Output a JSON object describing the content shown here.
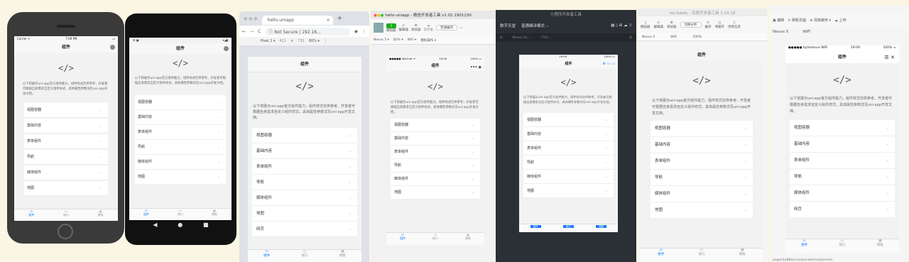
{
  "page": {
    "title": "组件",
    "code": "</>",
    "desc": "以下将展示uni-app官方组件能力，组件样式仅供参考，开发者可根据自身需求自定义组件样式，具体属性参数详见uni-app开发文档。"
  },
  "items": [
    "视图容器",
    "基础内容",
    "表单组件",
    "导航",
    "媒体组件",
    "地图",
    "网页"
  ],
  "tabs": {
    "home": "组件",
    "api": "接口",
    "tpl": "模板"
  },
  "iphone": {
    "carrier": "Carrier ᯤ",
    "time": "7:09 PM",
    "battery": "▭"
  },
  "browser": {
    "tab": "hello-uniapp",
    "secure": "Not Secure",
    "url": "192.16...",
    "device": "Pixel 2 ▾",
    "w": "411",
    "h": "731",
    "zoom": "80% ▾"
  },
  "wx": {
    "title": "hello-uniapp - 微信开发者工具 v1.02.1901230",
    "t1": "模拟器",
    "t2": "编辑器",
    "t3": "调试器",
    "t4": "云开发",
    "compile": "普通编译",
    "device": "Nexus 5 ▾",
    "zoom": "85% ▾",
    "net": "WiFi ▾",
    "op": "模拟操作 ▾",
    "sb_left": "●●●●● WeChat ᯤ",
    "sb_time": "19:09",
    "sb_right": "100% ▭"
  },
  "alipay": {
    "title": "小程序开发者工具",
    "left": "数字天堂",
    "mode": "普通编译模式 ⌵",
    "device": "Nexus 5x ⌵",
    "zoom": "75% ⌵",
    "sb_time": "19:09",
    "sb_right": "100% ▭"
  },
  "baidu": {
    "title": "mc-baidu - 百度开发者工具 1.14.18",
    "t1": "模拟器",
    "t2": "编辑器",
    "t3": "调试器",
    "mode": "切换分析",
    "compile": "编译",
    "clear": "清缓存",
    "detail": "项目信息",
    "device": "Nexus 5",
    "net": "WiFi",
    "zoom": "100%"
  },
  "tt": {
    "t1": "编辑",
    "t2": "刷新页面",
    "t3": "清除缓存",
    "t4": "上传",
    "device": "Nexus 5",
    "net": "WiFi",
    "sb_left": "●●●●● bytedance WiFi",
    "sb_time": "19:09",
    "sb_right": "100% ▭",
    "footer": "pages/tabBar/component/component"
  },
  "android": {
    "back": "◀",
    "home": "●",
    "recent": "■"
  }
}
